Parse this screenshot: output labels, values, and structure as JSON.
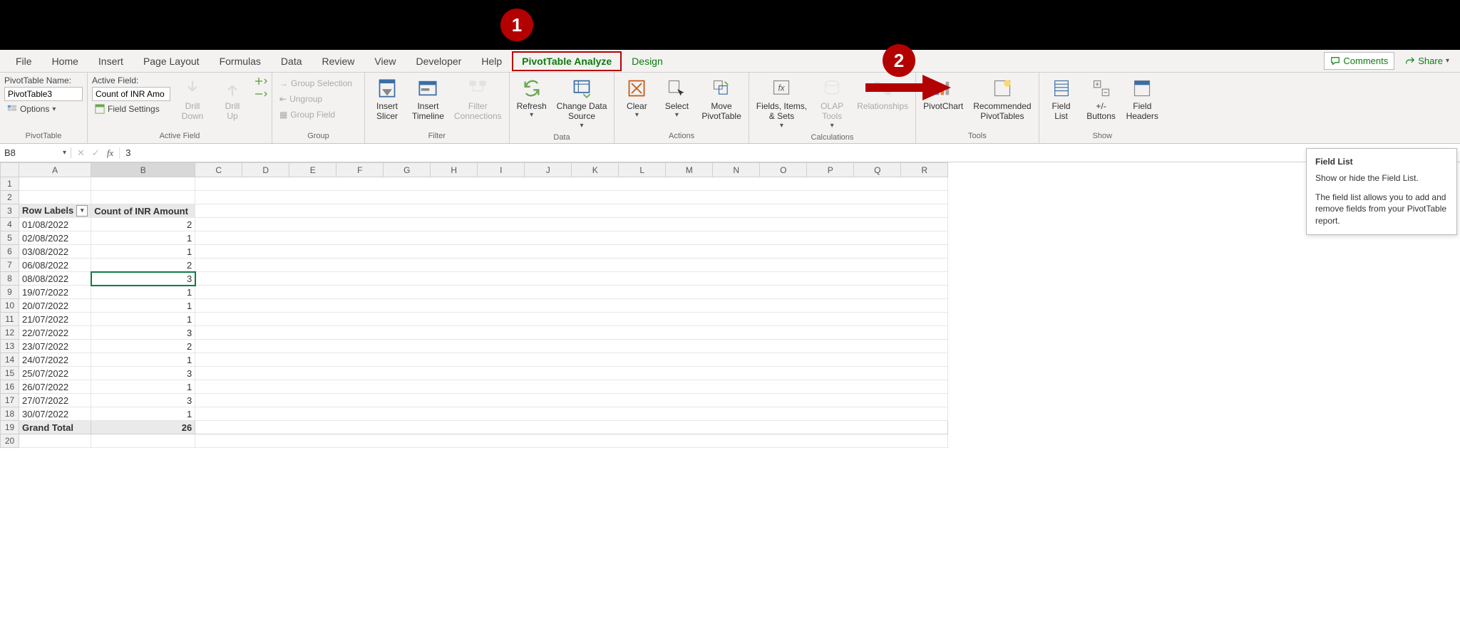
{
  "tabs": {
    "file": "File",
    "home": "Home",
    "insert": "Insert",
    "page_layout": "Page Layout",
    "formulas": "Formulas",
    "data": "Data",
    "review": "Review",
    "view": "View",
    "developer": "Developer",
    "help": "Help",
    "pivot_analyze": "PivotTable Analyze",
    "design": "Design"
  },
  "right": {
    "comments": "Comments",
    "share": "Share"
  },
  "pt": {
    "name_label": "PivotTable Name:",
    "name_value": "PivotTable3",
    "options": "Options",
    "group_label": "PivotTable"
  },
  "af": {
    "label": "Active Field:",
    "value": "Count of INR Amo",
    "settings": "Field Settings",
    "drill_down": "Drill\nDown",
    "drill_up": "Drill\nUp",
    "group_label": "Active Field"
  },
  "grp": {
    "sel": "Group Selection",
    "ungroup": "Ungroup",
    "field": "Group Field",
    "label": "Group"
  },
  "filter": {
    "slicer": "Insert\nSlicer",
    "timeline": "Insert\nTimeline",
    "conn": "Filter\nConnections",
    "label": "Filter"
  },
  "data_g": {
    "refresh": "Refresh",
    "change": "Change Data\nSource",
    "label": "Data"
  },
  "actions": {
    "clear": "Clear",
    "select": "Select",
    "move": "Move\nPivotTable",
    "label": "Actions"
  },
  "calc": {
    "fields": "Fields, Items,\n& Sets",
    "olap": "OLAP\nTools",
    "rel": "Relationships",
    "label": "Calculations"
  },
  "tools_g": {
    "chart": "PivotChart",
    "rec": "Recommended\nPivotTables",
    "label": "Tools"
  },
  "show": {
    "fieldlist": "Field\nList",
    "buttons": "+/-\nButtons",
    "headers": "Field\nHeaders",
    "label": "Show"
  },
  "namebox": "B8",
  "formula_value": "3",
  "columns": [
    "A",
    "B",
    "C",
    "D",
    "E",
    "F",
    "G",
    "H",
    "I",
    "J",
    "K",
    "L",
    "M",
    "N",
    "O",
    "P",
    "Q",
    "R"
  ],
  "pivot": {
    "rowlabel": "Row Labels",
    "valuelabel": "Count of INR Amount",
    "rows": [
      {
        "label": "01/08/2022",
        "value": "2"
      },
      {
        "label": "02/08/2022",
        "value": "1"
      },
      {
        "label": "03/08/2022",
        "value": "1"
      },
      {
        "label": "06/08/2022",
        "value": "2"
      },
      {
        "label": "08/08/2022",
        "value": "3"
      },
      {
        "label": "19/07/2022",
        "value": "1"
      },
      {
        "label": "20/07/2022",
        "value": "1"
      },
      {
        "label": "21/07/2022",
        "value": "1"
      },
      {
        "label": "22/07/2022",
        "value": "3"
      },
      {
        "label": "23/07/2022",
        "value": "2"
      },
      {
        "label": "24/07/2022",
        "value": "1"
      },
      {
        "label": "25/07/2022",
        "value": "3"
      },
      {
        "label": "26/07/2022",
        "value": "1"
      },
      {
        "label": "27/07/2022",
        "value": "3"
      },
      {
        "label": "30/07/2022",
        "value": "1"
      }
    ],
    "total_label": "Grand Total",
    "total_value": "26"
  },
  "tooltip": {
    "title": "Field List",
    "line1": "Show or hide the Field List.",
    "line2": "The field list allows you to add and remove fields from your PivotTable report."
  },
  "callouts": {
    "one": "1",
    "two": "2"
  }
}
